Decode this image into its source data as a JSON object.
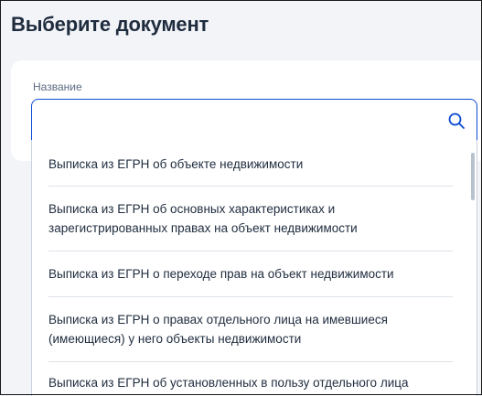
{
  "page": {
    "title": "Выберите документ"
  },
  "field": {
    "label": "Название",
    "value": "",
    "placeholder": ""
  },
  "icons": {
    "search": "search-icon"
  },
  "colors": {
    "accent": "#0d4cd3",
    "text": "#1f2c3e",
    "muted": "#5c6b80",
    "background": "#f2f4f8"
  },
  "options": [
    {
      "label": "Выписка из ЕГРН об объекте недвижимости"
    },
    {
      "label": "Выписка из ЕГРН об основных характеристиках и зарегистрированных правах на объект недвижимости"
    },
    {
      "label": "Выписка из ЕГРН о переходе прав на объект недвижимости"
    },
    {
      "label": "Выписка из ЕГРН о правах отдельного лица на имевшиеся (имеющиеся) у него объекты недвижимости"
    },
    {
      "label": "Выписка из ЕГРН об установленных в пользу отдельного лица"
    }
  ]
}
